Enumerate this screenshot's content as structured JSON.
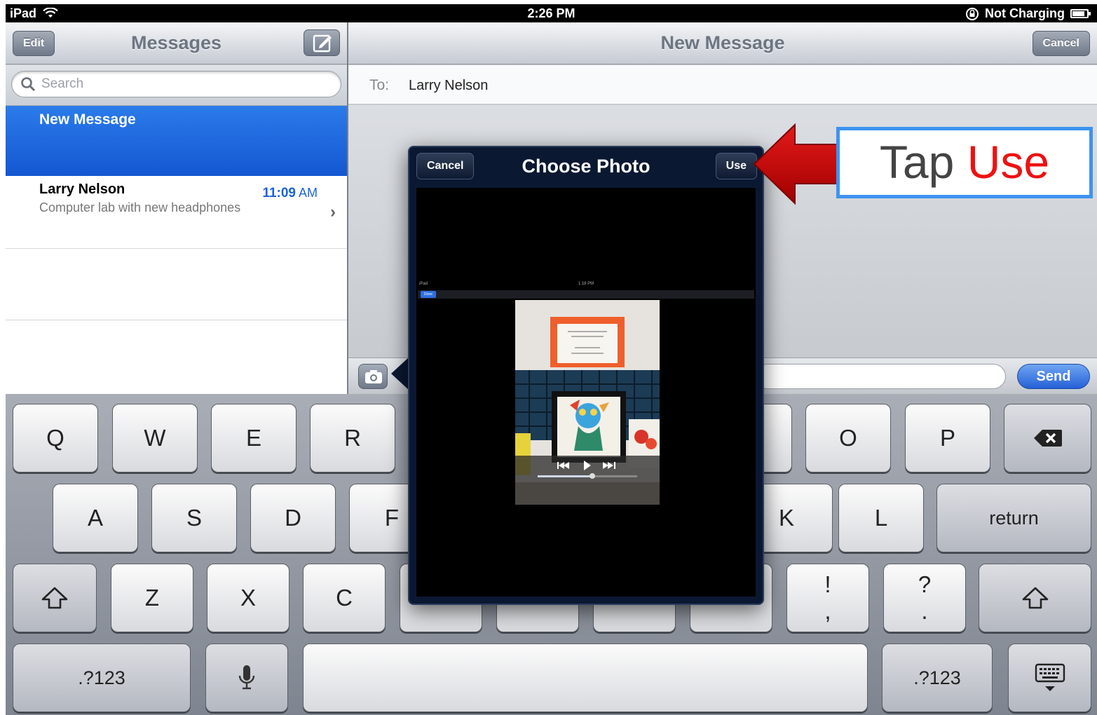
{
  "status_bar": {
    "device": "iPad",
    "time": "2:26 PM",
    "charging": "Not Charging",
    "battery_level": 0.85
  },
  "sidebar": {
    "title": "Messages",
    "edit_label": "Edit",
    "search_placeholder": "Search",
    "new_message_label": "New Message",
    "conversation": {
      "name": "Larry Nelson",
      "time": "11:09",
      "ampm": "AM",
      "preview": "Computer lab with new headphones"
    }
  },
  "compose": {
    "title": "New Message",
    "cancel_label": "Cancel",
    "to_label": "To:",
    "to_value": "Larry Nelson",
    "send_label": "Send"
  },
  "popover": {
    "title": "Choose Photo",
    "cancel_label": "Cancel",
    "use_label": "Use",
    "mini_status_device": "iPad",
    "mini_status_time": "1:18 PM",
    "mini_done_label": "Done"
  },
  "keyboard": {
    "row1": [
      "Q",
      "W",
      "E",
      "R",
      "O",
      "P"
    ],
    "row2": [
      "A",
      "S",
      "D",
      "F",
      "K",
      "L"
    ],
    "return_label": "return",
    "row3": [
      "Z",
      "X",
      "C"
    ],
    "exclaim_top": "!",
    "exclaim_bottom": ",",
    "question_top": "?",
    "question_bottom": ".",
    "numbers_label": ".?123"
  },
  "annotation": {
    "word1": "Tap",
    "word2": "Use",
    "arrow_color": "#cc0000"
  },
  "colors": {
    "accent": "#1a63d8",
    "selected_row": "#1b63dc",
    "callout_border": "#3d93f0",
    "callout_highlight": "#ee1111"
  }
}
